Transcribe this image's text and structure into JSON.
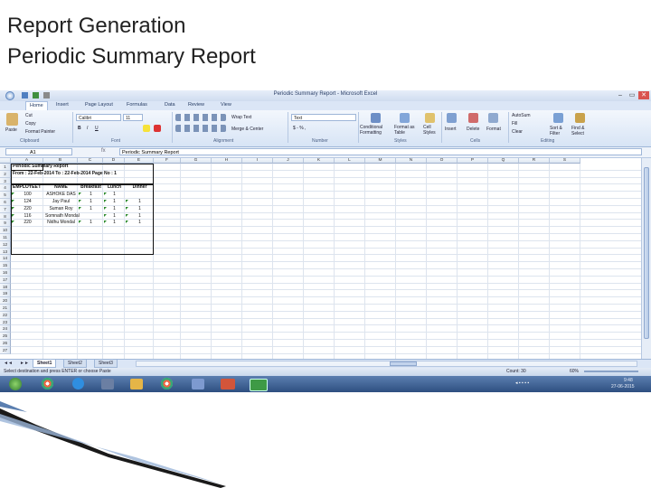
{
  "slide": {
    "title_line1": "Report Generation",
    "title_line2": "Periodic  Summary Report"
  },
  "window": {
    "title": "Periodic Summary Report - Microsoft Excel",
    "minimize": "–",
    "restore": "▭",
    "close": "✕"
  },
  "ribbon_tabs": [
    "Home",
    "Insert",
    "Page Layout",
    "Formulas",
    "Data",
    "Review",
    "View"
  ],
  "ribbon": {
    "paste": "Paste",
    "cut": "Cut",
    "copy": "Copy",
    "format_painter": "Format Painter",
    "font_name": "Calibri",
    "font_size": "11",
    "wrap_text": "Wrap Text",
    "merge_center": "Merge & Center",
    "number_format": "Text",
    "conditional_formatting": "Conditional Formatting",
    "format_as_table": "Format as Table",
    "cell_styles": "Cell Styles",
    "insert": "Insert",
    "delete": "Delete",
    "format": "Format",
    "autosum": "AutoSum",
    "fill": "Fill",
    "clear": "Clear",
    "sort_filter": "Sort & Filter",
    "find_select": "Find & Select",
    "groups": [
      "Clipboard",
      "Font",
      "Alignment",
      "Number",
      "Styles",
      "Cells",
      "Editing"
    ]
  },
  "formula_bar": {
    "name_box": "A1",
    "fx": "fx",
    "value": "Periodic Summary Report"
  },
  "columns": [
    "A",
    "B",
    "C",
    "D",
    "E",
    "F",
    "G",
    "H",
    "I",
    "J",
    "K",
    "L",
    "M",
    "N",
    "O",
    "P",
    "Q",
    "R",
    "S"
  ],
  "rows": [
    "1",
    "2",
    "3",
    "4",
    "5",
    "6",
    "7",
    "8",
    "9",
    "10",
    "11",
    "12",
    "13",
    "14",
    "15",
    "16",
    "17",
    "18",
    "19",
    "20",
    "21",
    "22",
    "23",
    "24",
    "25",
    "26",
    "27"
  ],
  "cells": {
    "r1": "Periodic Summary Report",
    "r2": "From : 22-Feb-2014 To : 22-Feb-2014 Page No : 1",
    "headers": [
      "EMPLOYEE I",
      "NAME",
      "Breakfast",
      "Lunch",
      "Dinner"
    ],
    "data": [
      [
        "100",
        "ASHOKE DAS",
        "1",
        "1",
        ""
      ],
      [
        "124",
        "Jay Paul",
        "1",
        "1",
        "1"
      ],
      [
        "220",
        "Suman Roy",
        "1",
        "1",
        "1"
      ],
      [
        "116",
        "Somnath Mondal",
        "",
        "1",
        "1"
      ],
      [
        "220",
        "Nidhu Mondal",
        "1",
        "1",
        "1"
      ]
    ]
  },
  "sheet_tabs": [
    "Sheet1",
    "Sheet2",
    "Sheet3"
  ],
  "status": {
    "message": "Select destination and press ENTER or choose Paste",
    "count": "Count: 30",
    "zoom": "60%"
  },
  "taskbar": {
    "time": "9:48",
    "date": "27-06-2015"
  }
}
